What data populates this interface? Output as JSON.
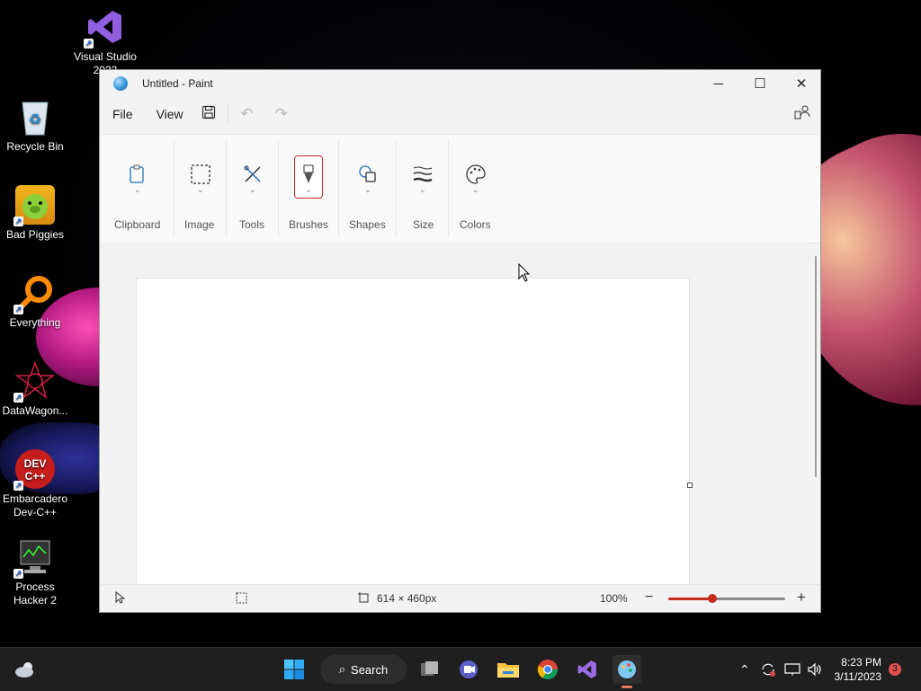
{
  "desktop": {
    "icons": [
      {
        "label": "Visual Studio 2022",
        "icon": "visual-studio-icon"
      },
      {
        "label": "Recycle Bin",
        "icon": "recycle-bin-icon"
      },
      {
        "label": "Bad Piggies",
        "icon": "bad-piggies-icon"
      },
      {
        "label": "Everything",
        "icon": "everything-search-icon"
      },
      {
        "label": "DataWagon...",
        "icon": "datawagon-icon"
      },
      {
        "label": "Embarcadero Dev-C++",
        "icon": "devcpp-icon"
      },
      {
        "label": "Process Hacker 2",
        "icon": "process-hacker-icon"
      }
    ]
  },
  "window": {
    "title": "Untitled - Paint",
    "controls": {
      "minimize": "─",
      "maximize": "☐",
      "close": "✕"
    }
  },
  "menubar": {
    "file": "File",
    "view": "View"
  },
  "ribbon": {
    "groups": [
      {
        "label": "Clipboard",
        "icon": "clipboard-icon"
      },
      {
        "label": "Image",
        "icon": "selection-icon"
      },
      {
        "label": "Tools",
        "icon": "tools-icon"
      },
      {
        "label": "Brushes",
        "icon": "brush-icon"
      },
      {
        "label": "Shapes",
        "icon": "shapes-icon"
      },
      {
        "label": "Size",
        "icon": "size-icon"
      },
      {
        "label": "Colors",
        "icon": "palette-icon"
      }
    ]
  },
  "status": {
    "canvas_size": "614 × 460px",
    "zoom": "100%",
    "zoom_fraction": 0.38
  },
  "taskbar": {
    "search_label": "Search",
    "time": "8:23 PM",
    "date": "3/11/2023",
    "notifications": "3"
  }
}
